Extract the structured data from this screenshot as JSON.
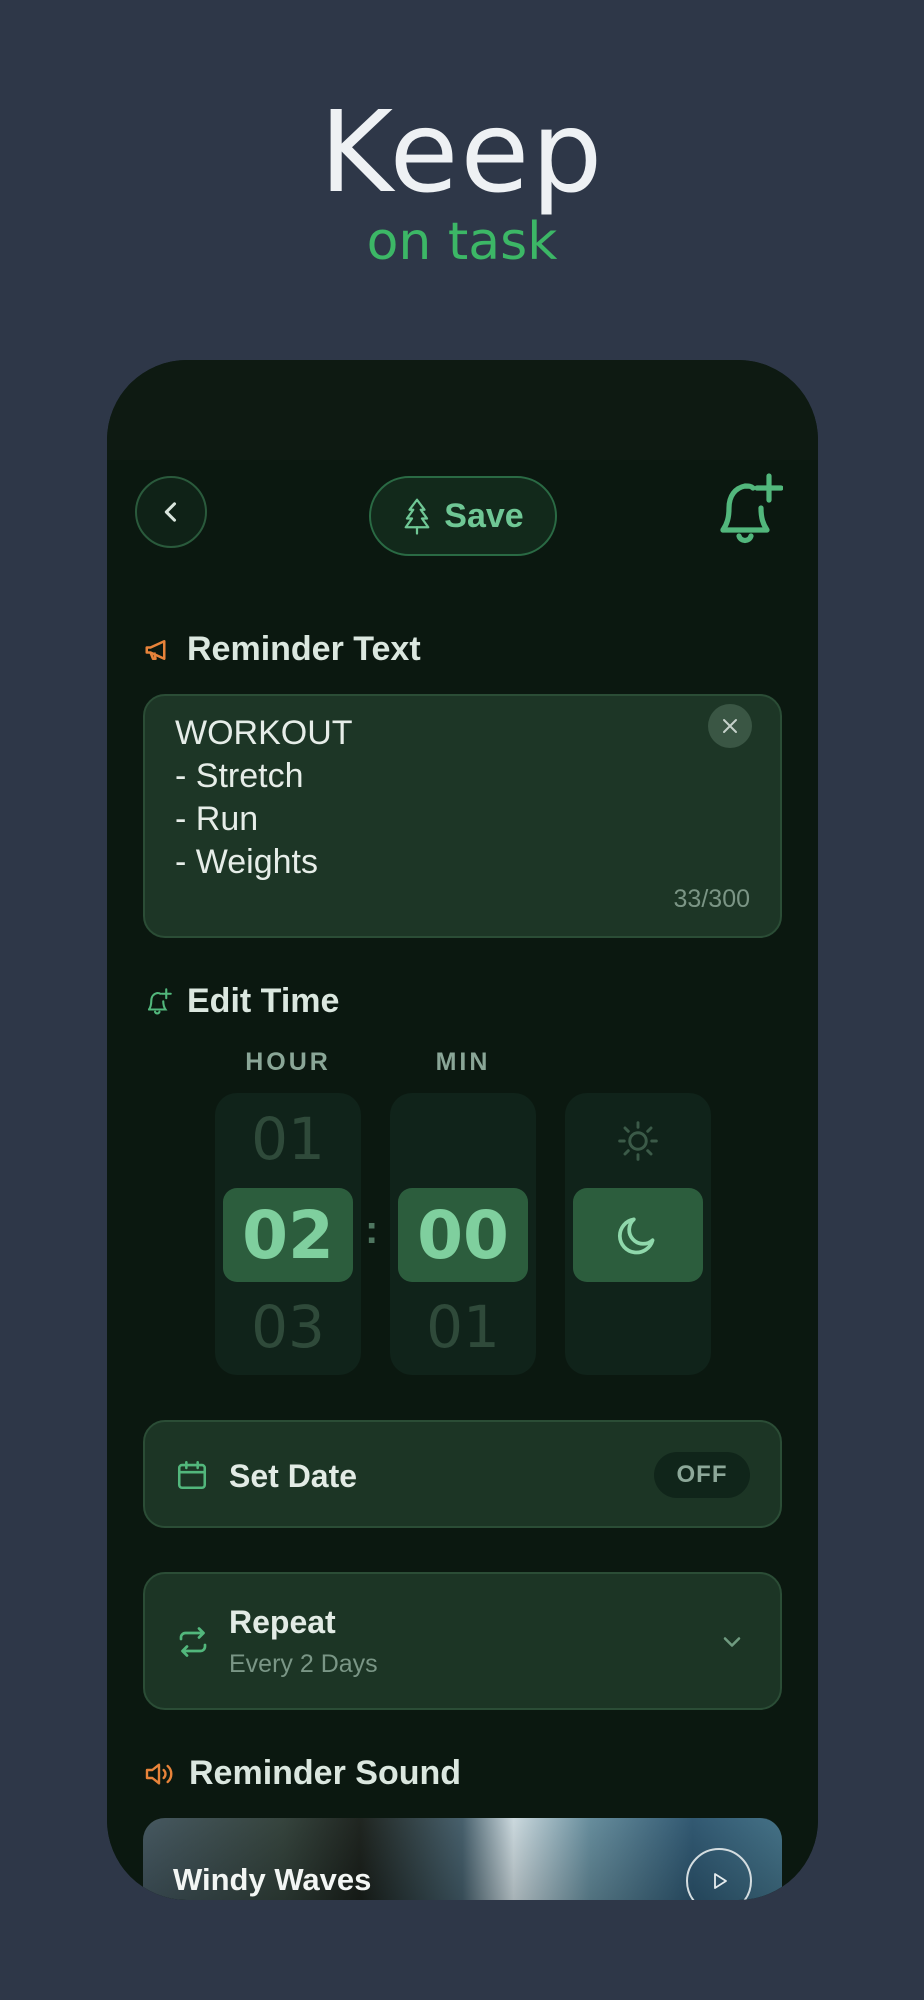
{
  "hero": {
    "title": "Keep",
    "subtitle": "on task"
  },
  "toolbar": {
    "save_label": "Save"
  },
  "reminder_text": {
    "heading": "Reminder Text",
    "lines": [
      "WORKOUT",
      "- Stretch",
      "- Run",
      "- Weights"
    ],
    "counter": "33/300"
  },
  "edit_time": {
    "heading": "Edit Time",
    "hour_label": "HOUR",
    "min_label": "MIN",
    "hour_prev": "01",
    "hour_selected": "02",
    "hour_next": "03",
    "min_selected": "00",
    "min_next": "01",
    "period_options": [
      "sun-icon",
      "moon-icon"
    ],
    "period_selected": "moon-icon"
  },
  "set_date": {
    "label": "Set Date",
    "state": "OFF"
  },
  "repeat": {
    "label": "Repeat",
    "value": "Every 2 Days"
  },
  "reminder_sound": {
    "heading": "Reminder Sound",
    "selected": "Windy Waves"
  },
  "colors": {
    "background": "#2e3748",
    "accent_green": "#3cb766",
    "section_icon_orange": "#e8833a",
    "card": "#1c3525"
  }
}
